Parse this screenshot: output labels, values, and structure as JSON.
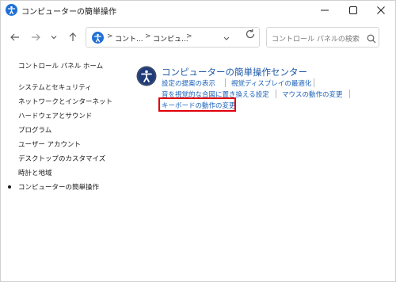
{
  "window": {
    "title": "コンピューターの簡単操作"
  },
  "address": {
    "crumb1": "コント...",
    "crumb2": "コンピュ...",
    "search_placeholder": "コントロール パネルの検索"
  },
  "sidebar": {
    "home": "コントロール パネル ホーム",
    "items": [
      {
        "label": "システムとセキュリティ"
      },
      {
        "label": "ネットワークとインターネット"
      },
      {
        "label": "ハードウェアとサウンド"
      },
      {
        "label": "プログラム"
      },
      {
        "label": "ユーザー アカウント"
      },
      {
        "label": "デスクトップのカスタマイズ"
      },
      {
        "label": "時計と地域"
      },
      {
        "label": "コンピューターの簡単操作"
      }
    ]
  },
  "main": {
    "title": "コンピューターの簡単操作センター",
    "links": {
      "setting_suggestions": "設定の提案の表示",
      "optimize_display": "視覚ディスプレイの最適化",
      "sound_to_visual": "音を視覚的な合図に置き換える設定",
      "mouse_settings": "マウスの動作の変更",
      "keyboard_settings": "キーボードの動作の変更"
    }
  },
  "colors": {
    "link": "#1c62b9",
    "title": "#1e5aa8",
    "highlight": "#e0000b",
    "accent": "#1f6fd6"
  }
}
